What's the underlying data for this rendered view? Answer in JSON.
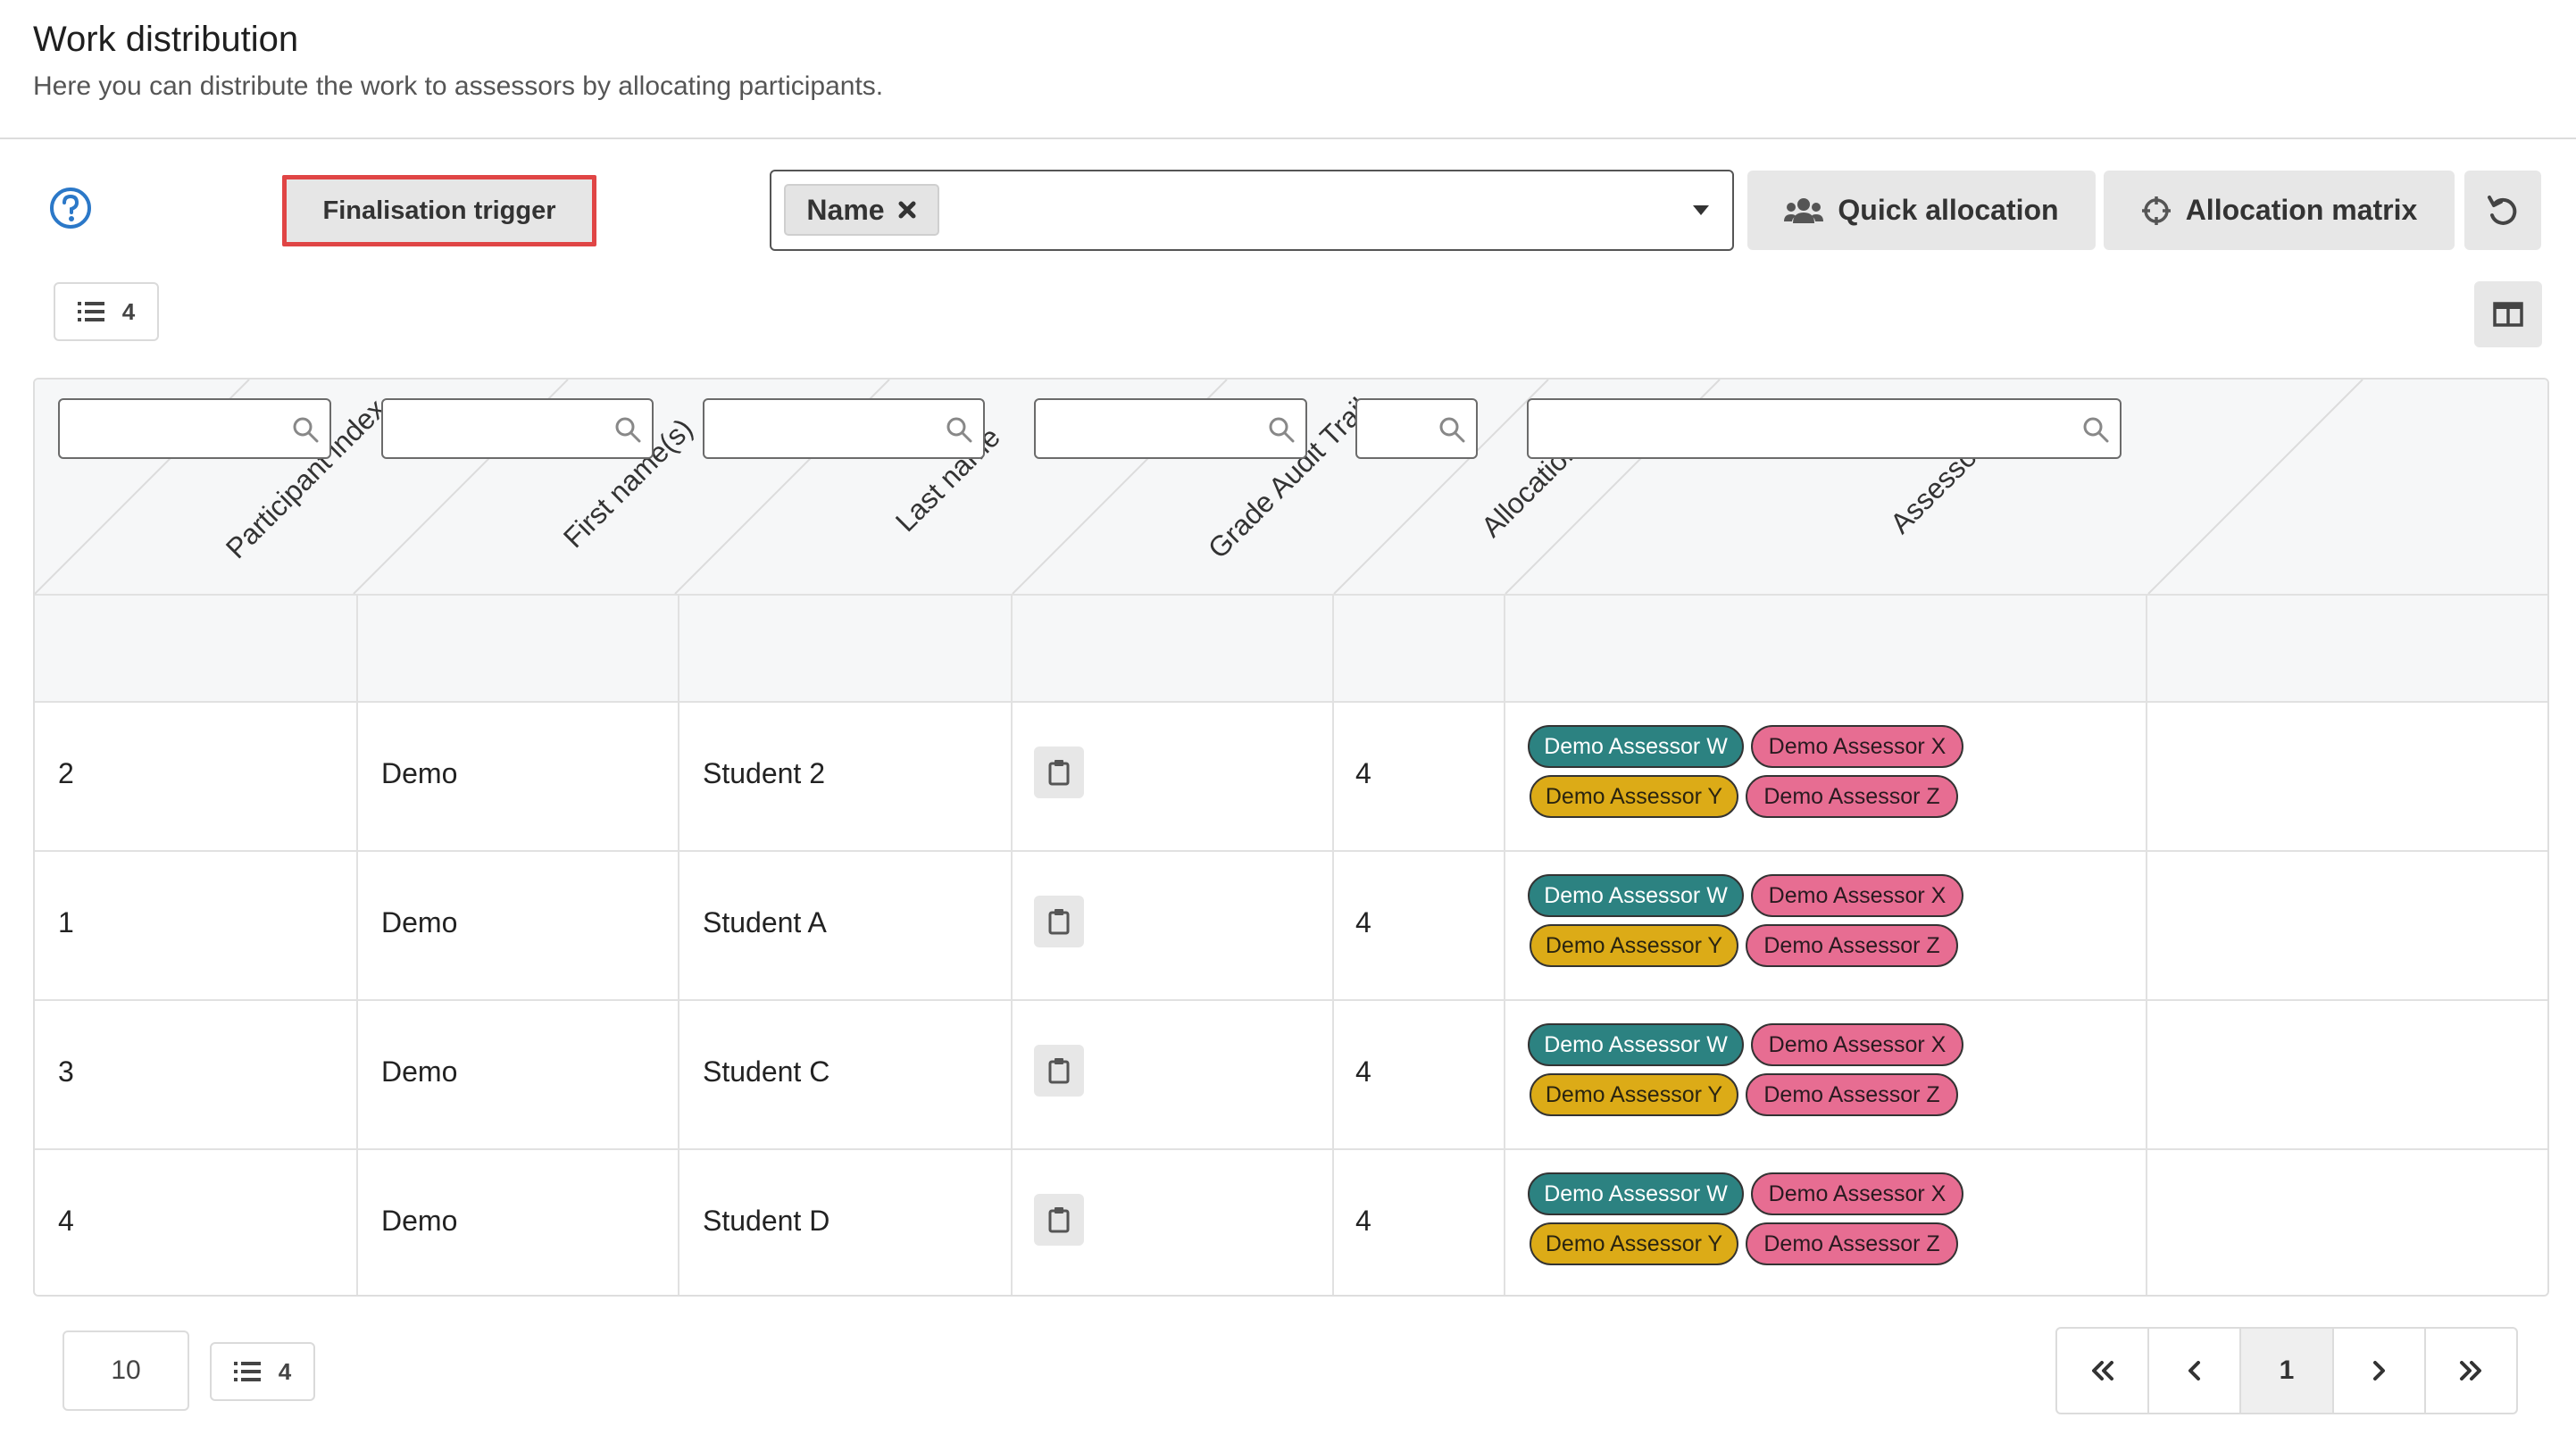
{
  "header": {
    "title": "Work distribution",
    "subtitle": "Here you can distribute the work to assessors by allocating participants."
  },
  "toolbar": {
    "finalisation_label": "Finalisation trigger",
    "grouping_tag": "Name",
    "quick_allocation_label": "Quick allocation",
    "allocation_matrix_label": "Allocation matrix",
    "row_count": "4"
  },
  "table": {
    "columns": [
      "Participant index",
      "First name(s)",
      "Last name",
      "Grade Audit Trail",
      "Allocations",
      "Assessors"
    ],
    "rows": [
      {
        "index": "2",
        "first": "Demo",
        "last": "Student 2",
        "allocations": "4"
      },
      {
        "index": "1",
        "first": "Demo",
        "last": "Student A",
        "allocations": "4"
      },
      {
        "index": "3",
        "first": "Demo",
        "last": "Student C",
        "allocations": "4"
      },
      {
        "index": "4",
        "first": "Demo",
        "last": "Student D",
        "allocations": "4"
      }
    ],
    "assessors": [
      "Demo Assessor W",
      "Demo Assessor X",
      "Demo Assessor Y",
      "Demo Assessor Z"
    ],
    "assessor_colors": {
      "W": "#2c8281",
      "X": "#e76d92",
      "Y": "#dcab17",
      "Z": "#e76d92"
    }
  },
  "footer": {
    "per_page": "10",
    "row_count": "4",
    "current_page": "1"
  },
  "icons": [
    "help-circle-icon",
    "close-x-icon",
    "users-icon",
    "crosshair-icon",
    "reset-icon",
    "list-icon",
    "columns-icon",
    "search-icon",
    "clipboard-icon",
    "first-page-icon",
    "prev-page-icon",
    "next-page-icon",
    "last-page-icon"
  ]
}
